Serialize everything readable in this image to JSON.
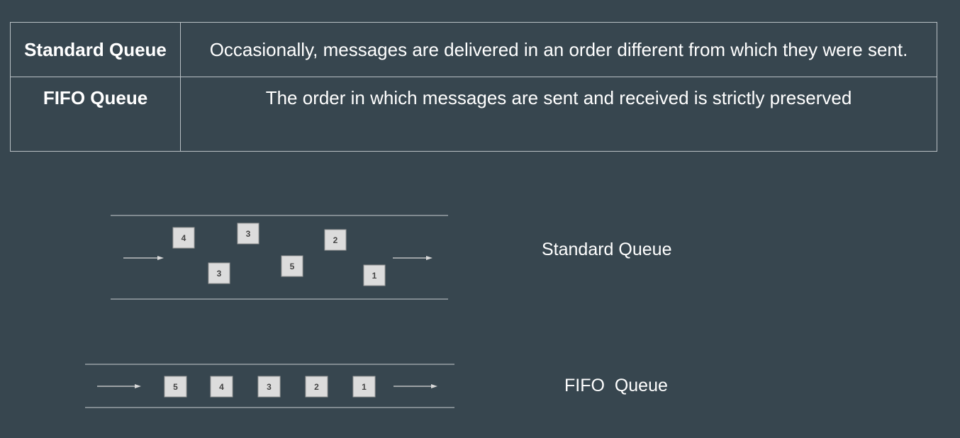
{
  "table": {
    "rows": [
      {
        "name": "Standard Queue",
        "description": "Occasionally, messages are delivered in an order different from which they were sent."
      },
      {
        "name": "FIFO Queue",
        "description": "The order in which messages are sent and received is strictly preserved"
      }
    ]
  },
  "diagram": {
    "standard": {
      "caption": "Standard Queue",
      "messages": [
        "4",
        "3",
        "3",
        "5",
        "2",
        "1"
      ]
    },
    "fifo": {
      "caption": "FIFO  Queue",
      "messages": [
        "5",
        "4",
        "3",
        "2",
        "1"
      ]
    }
  }
}
